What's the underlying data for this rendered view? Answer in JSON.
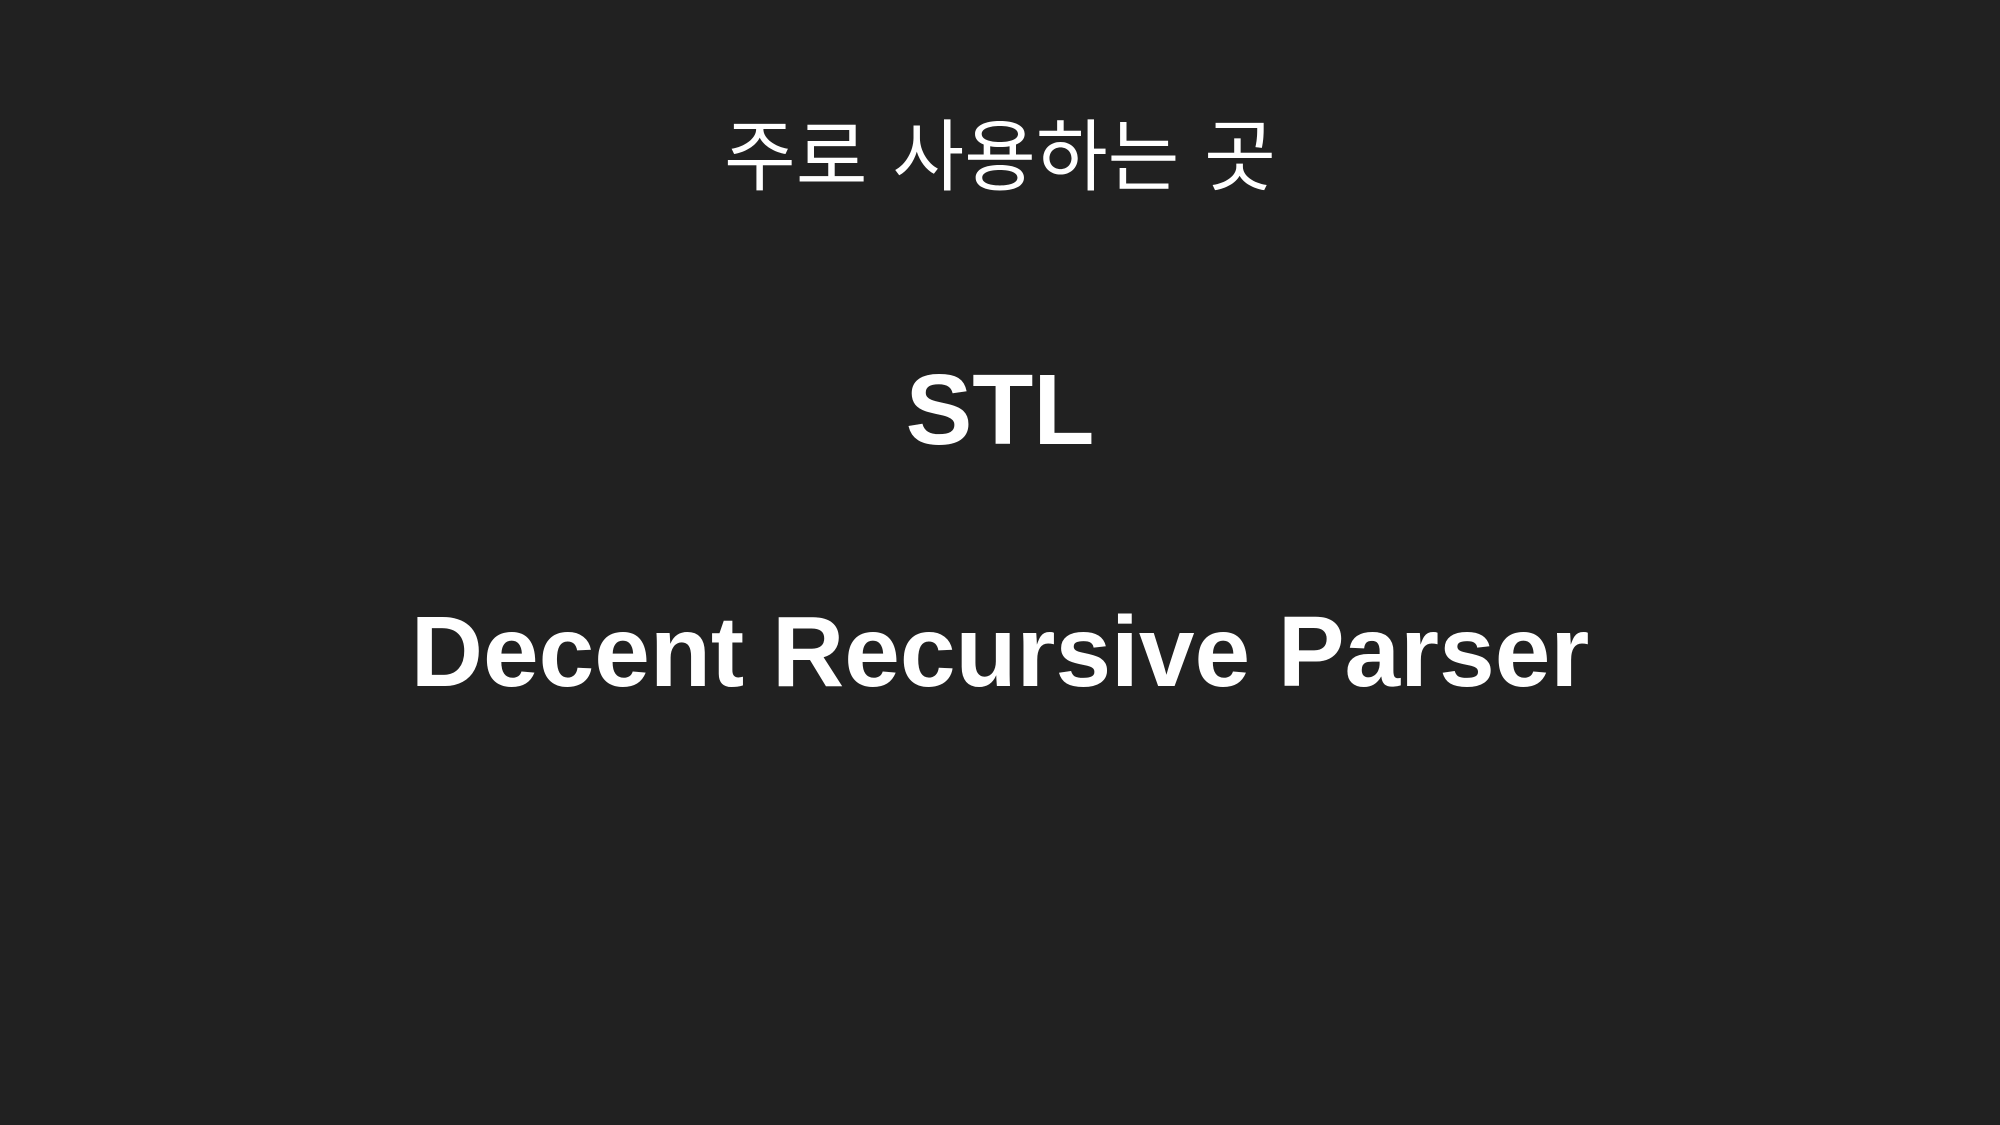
{
  "slide": {
    "heading": "주로 사용하는 곳",
    "items": [
      "STL",
      "Decent Recursive Parser"
    ]
  },
  "colors": {
    "background": "#212121",
    "text": "#ffffff"
  }
}
